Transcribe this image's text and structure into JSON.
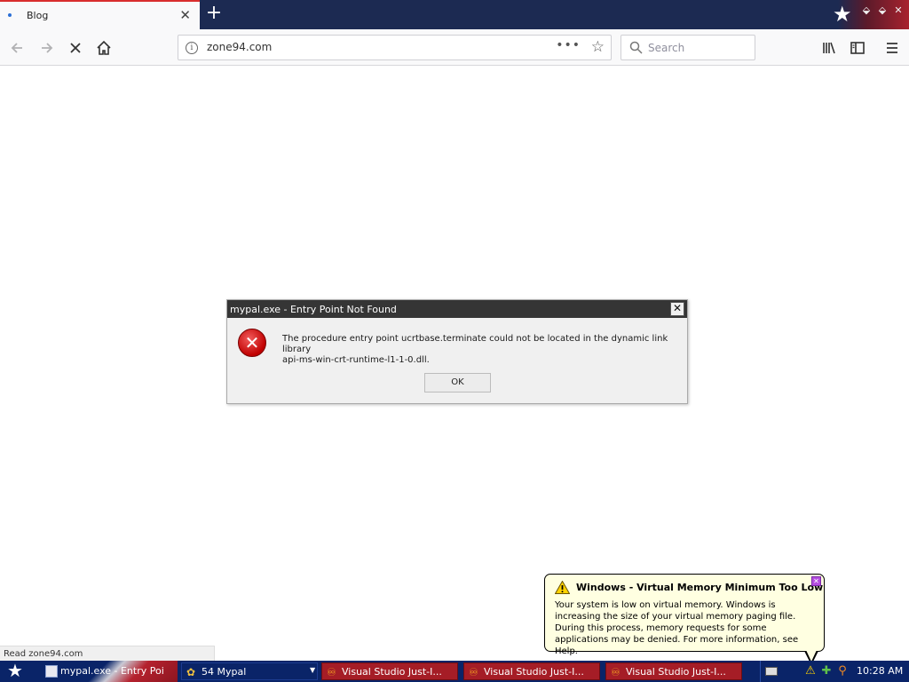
{
  "browser": {
    "tab": {
      "title": "Blog",
      "close_glyph": "✕"
    },
    "new_tab_glyph": "+",
    "url": "zone94.com",
    "url_more_glyph": "•••",
    "bookmark_glyph": "☆",
    "search_placeholder": "Search",
    "status_text": "Read zone94.com"
  },
  "dialog": {
    "title": "mypal.exe - Entry Point Not Found",
    "close_glyph": "✕",
    "message_line1": "The procedure entry point ucrtbase.terminate could not be located in the dynamic link library",
    "message_line2": "api-ms-win-crt-runtime-l1-1-0.dll.",
    "ok_label": "OK",
    "icon": "error-icon"
  },
  "balloon": {
    "title": "Windows - Virtual Memory Minimum Too Low",
    "text": "Your system is low on virtual memory. Windows is increasing the size of your virtual memory paging file. During this process, memory requests for some applications may be denied. For more information, see Help.",
    "icon": "warning-icon"
  },
  "taskbar": {
    "items": [
      {
        "label": "mypal.exe - Entry Poi"
      },
      {
        "label": "54 Mypal"
      },
      {
        "label": "Visual Studio Just-I..."
      },
      {
        "label": "Visual Studio Just-I..."
      },
      {
        "label": "Visual Studio Just-I..."
      }
    ],
    "clock": "10:28 AM"
  },
  "colors": {
    "tab_strip": "#1c2a52",
    "taskbar": "#0a2468",
    "dialog_titlebar": "#353535",
    "balloon_bg": "#ffffe1",
    "taskbar_vs_item": "#a51d26"
  }
}
